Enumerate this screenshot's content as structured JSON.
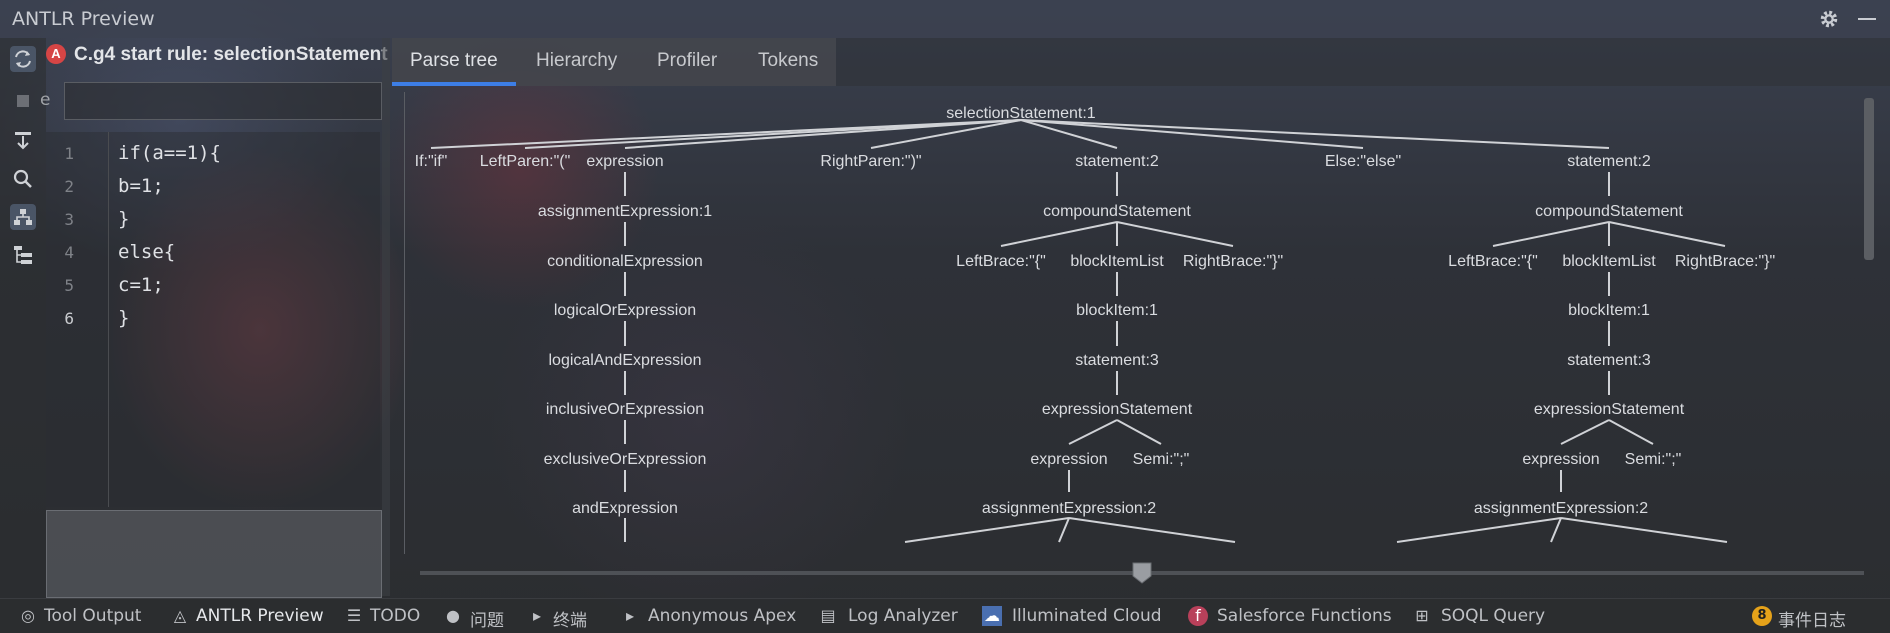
{
  "window": {
    "title": "ANTLR Preview"
  },
  "editor": {
    "header_label": "C.g4 start rule: selectionStatement",
    "badge_letter": "A",
    "input_label": "e",
    "input_value": "",
    "lines": [
      {
        "num": "1",
        "code": "if(a==1){"
      },
      {
        "num": "2",
        "code": "b=1;"
      },
      {
        "num": "3",
        "code": "}"
      },
      {
        "num": "4",
        "code": "else{"
      },
      {
        "num": "5",
        "code": "c=1;"
      },
      {
        "num": "6",
        "code": "}"
      }
    ]
  },
  "tabs": [
    {
      "label": "Parse tree",
      "active": true
    },
    {
      "label": "Hierarchy"
    },
    {
      "label": "Profiler"
    },
    {
      "label": "Tokens"
    }
  ],
  "parse_tree": {
    "nodes": [
      "selectionStatement:1",
      "If:\"if\"",
      "LeftParen:\"(\"",
      "expression",
      "RightParen:\")\"",
      "statement:2",
      "Else:\"else\"",
      "statement:2",
      "assignmentExpression:1",
      "conditionalExpression",
      "logicalOrExpression",
      "logicalAndExpression",
      "inclusiveOrExpression",
      "exclusiveOrExpression",
      "andExpression",
      "compoundStatement",
      "LeftBrace:\"{\"",
      "blockItemList",
      "RightBrace:\"}\"",
      "blockItem:1",
      "statement:3",
      "expressionStatement",
      "expression",
      "Semi:\";\"",
      "assignmentExpression:2",
      "compoundStatement",
      "LeftBrace:\"{\"",
      "blockItemList",
      "RightBrace:\"}\"",
      "blockItem:1",
      "statement:3",
      "expressionStatement",
      "expression",
      "Semi:\";\"",
      "assignmentExpression:2"
    ]
  },
  "status_bar": {
    "items": [
      {
        "label": "Tool Output",
        "icon": "tool-output-icon"
      },
      {
        "label": "ANTLR Preview",
        "icon": "antlr-icon",
        "active": true
      },
      {
        "label": "TODO",
        "icon": "list-icon"
      },
      {
        "label": "问题",
        "icon": "problems-icon"
      },
      {
        "label": "终端",
        "icon": "terminal-icon"
      },
      {
        "label": "Anonymous Apex",
        "icon": "apex-icon"
      },
      {
        "label": "Log Analyzer",
        "icon": "log-icon"
      },
      {
        "label": "Illuminated Cloud",
        "icon": "cloud-icon"
      },
      {
        "label": "Salesforce Functions",
        "icon": "functions-icon"
      },
      {
        "label": "SOQL Query",
        "icon": "soql-icon"
      }
    ],
    "event_count": "8",
    "event_label": "事件日志"
  },
  "colors": {
    "accent": "#3d7ee6",
    "badge": "#d64545",
    "event": "#e5a21a"
  }
}
